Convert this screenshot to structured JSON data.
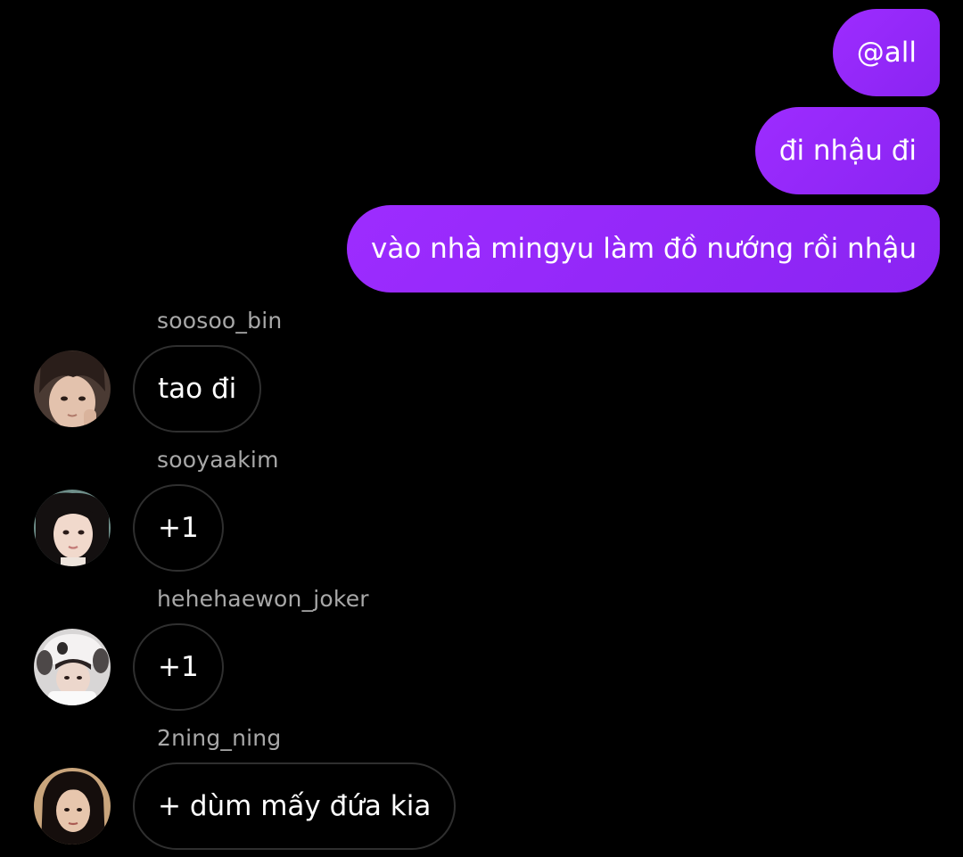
{
  "outgoing": [
    {
      "text": "@all"
    },
    {
      "text": "đi nhậu đi"
    },
    {
      "text": "vào nhà mingyu làm đồ nướng rồi nhậu"
    }
  ],
  "incoming": [
    {
      "sender": "soosoo_bin",
      "text": "tao đi",
      "avatar": "avatar-photo"
    },
    {
      "sender": "sooyaakim",
      "text": "+1",
      "avatar": "avatar-photo"
    },
    {
      "sender": "hehehaewon_joker",
      "text": "+1",
      "avatar": "avatar-photo"
    },
    {
      "sender": "2ning_ning",
      "text": "+ dùm mấy đứa kia",
      "avatar": "avatar-photo"
    }
  ],
  "colors": {
    "background": "#000000",
    "outgoing_bubble": "#8f27f5",
    "incoming_border": "#2f2f2f",
    "sender_name": "#a8a8a8",
    "text": "#ffffff"
  }
}
